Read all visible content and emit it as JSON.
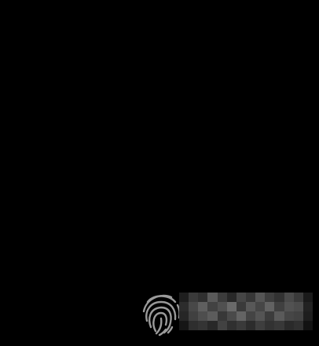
{
  "screen": {
    "background_color": "#000000"
  },
  "auth": {
    "icon": "fingerprint-icon",
    "icon_color": "#9a9a9a",
    "label": ""
  }
}
